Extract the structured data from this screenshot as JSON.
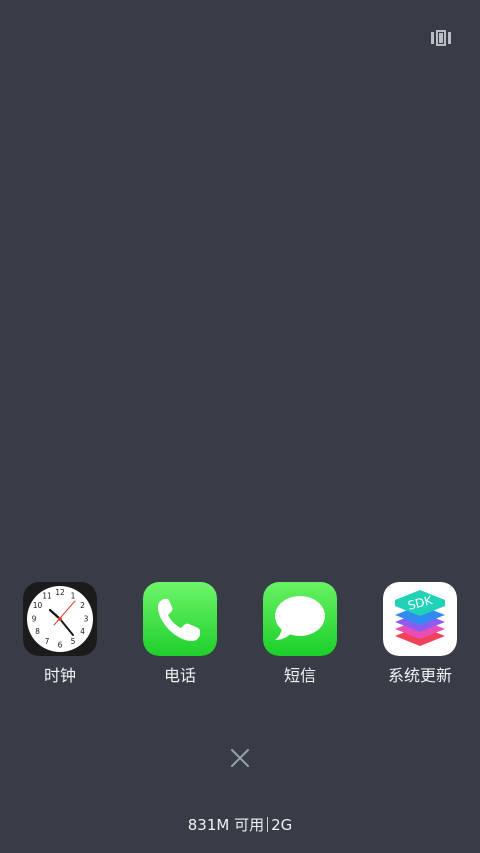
{
  "toolbar": {
    "layout_icon": "layout-toggle-icon"
  },
  "apps": [
    {
      "label": "时钟",
      "icon": "clock-icon"
    },
    {
      "label": "电话",
      "icon": "phone-icon"
    },
    {
      "label": "短信",
      "icon": "messages-icon"
    },
    {
      "label": "系统更新",
      "icon": "sdk-update-icon",
      "icon_text": "SDK"
    }
  ],
  "close": {
    "icon": "close-icon"
  },
  "memory": {
    "available": "831M 可用",
    "total": "2G"
  },
  "colors": {
    "background": "#383c47",
    "phone_green": "#2fd63a",
    "message_green": "#2cd93a",
    "clock_second_hand": "#e8422c"
  }
}
